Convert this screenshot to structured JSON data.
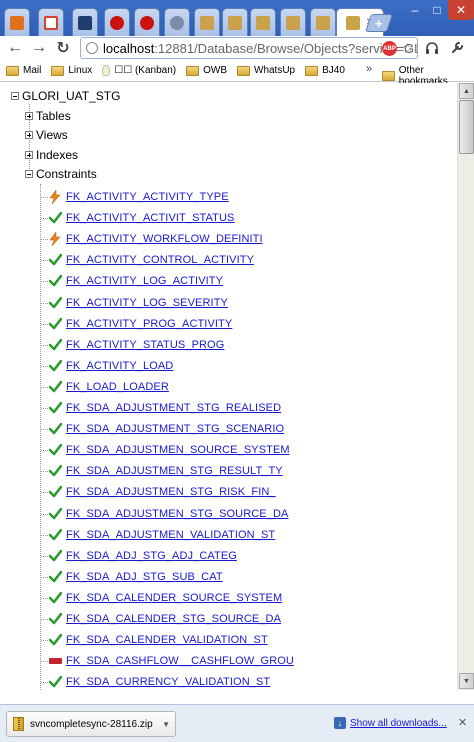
{
  "browser": {
    "tabs": [
      {
        "icon": "tc-icon",
        "color": "#e0701c"
      },
      {
        "icon": "gmail-icon",
        "color": "#d94030"
      },
      {
        "icon": "x-app-icon",
        "color": "#1e3c6c"
      },
      {
        "icon": "opera-icon",
        "color": "#cc1111"
      },
      {
        "icon": "opera-icon",
        "color": "#cc1111"
      },
      {
        "icon": "globe-icon",
        "color": "#7b8ca8"
      },
      {
        "icon": "page-icon",
        "color": "#c9a24a"
      },
      {
        "icon": "page-icon",
        "color": "#c9a24a"
      },
      {
        "icon": "page-icon",
        "color": "#c9a24a"
      },
      {
        "icon": "page-icon",
        "color": "#c9a24a"
      },
      {
        "icon": "page-icon",
        "color": "#c9a24a"
      }
    ],
    "active_tab_close": "✕",
    "new_tab": "+",
    "window_buttons": {
      "minimize": "–",
      "maximize": "□",
      "close": "✕"
    },
    "url_host": "localhost",
    "url_path": ":12881/Database/Browse/Objects?service=GLC",
    "abp_label": "ABP",
    "bookmarks": [
      {
        "label": "Mail",
        "icon": "folder-icon"
      },
      {
        "label": "Linux",
        "icon": "folder-icon"
      },
      {
        "label": "☐☐ (Kanban)",
        "icon": "bulb-icon"
      },
      {
        "label": "OWB",
        "icon": "folder-icon"
      },
      {
        "label": "WhatsUp",
        "icon": "folder-icon"
      },
      {
        "label": "BJ40",
        "icon": "folder-icon"
      }
    ],
    "bookmarks_overflow": "»",
    "other_bookmarks": "Other bookmarks"
  },
  "tree": {
    "root": "GLORI_UAT_STG",
    "nodes": [
      {
        "label": "Tables",
        "expanded": false
      },
      {
        "label": "Views",
        "expanded": false
      },
      {
        "label": "Indexes",
        "expanded": false
      },
      {
        "label": "Constraints",
        "expanded": true
      }
    ],
    "constraints": [
      {
        "name": "FK_ACTIVITY_ACTIVITY_TYPE",
        "status": "lightning"
      },
      {
        "name": "FK_ACTIVITY_ACTIVIT_STATUS",
        "status": "check"
      },
      {
        "name": "FK_ACTIVITY_WORKFLOW_DEFINITI",
        "status": "lightning"
      },
      {
        "name": "FK_ACTIVITY_CONTROL_ACTIVITY",
        "status": "check"
      },
      {
        "name": "FK_ACTIVITY_LOG_ACTIVITY",
        "status": "check"
      },
      {
        "name": "FK_ACTIVITY_LOG_SEVERITY",
        "status": "check"
      },
      {
        "name": "FK_ACTIVITY_PROG_ACTIVITY",
        "status": "check"
      },
      {
        "name": "FK_ACTIVITY_STATUS_PROG",
        "status": "check"
      },
      {
        "name": "FK_ACTIVITY_LOAD",
        "status": "check"
      },
      {
        "name": "FK_LOAD_LOADER",
        "status": "check"
      },
      {
        "name": "FK_SDA_ADJUSTMENT_STG_REALISED",
        "status": "check"
      },
      {
        "name": "FK_SDA_ADJUSTMENT_STG_SCENARIO",
        "status": "check"
      },
      {
        "name": "FK_SDA_ADJUSTMEN_SOURCE_SYSTEM",
        "status": "check"
      },
      {
        "name": "FK_SDA_ADJUSTMEN_STG_RESULT_TY",
        "status": "check"
      },
      {
        "name": "FK_SDA_ADJUSTMEN_STG_RISK_FIN_",
        "status": "check"
      },
      {
        "name": "FK_SDA_ADJUSTMEN_STG_SOURCE_DA",
        "status": "check"
      },
      {
        "name": "FK_SDA_ADJUSTMEN_VALIDATION_ST",
        "status": "check"
      },
      {
        "name": "FK_SDA_ADJ_STG_ADJ_CATEG",
        "status": "check"
      },
      {
        "name": "FK_SDA_ADJ_STG_SUB_CAT",
        "status": "check"
      },
      {
        "name": "FK_SDA_CALENDER_SOURCE_SYSTEM",
        "status": "check"
      },
      {
        "name": "FK_SDA_CALENDER_STG_SOURCE_DA",
        "status": "check"
      },
      {
        "name": "FK_SDA_CALENDER_VALIDATION_ST",
        "status": "check"
      },
      {
        "name": "FK_SDA_CASHFLOW__CASHFLOW_GROU",
        "status": "disabled"
      },
      {
        "name": "FK_SDA_CURRENCY_VALIDATION_ST",
        "status": "check"
      }
    ]
  },
  "download_shelf": {
    "file": "svncompletesync-28116.zip",
    "dropdown": "▼",
    "show_all": "Show all downloads...",
    "close": "✕"
  },
  "colors": {
    "link": "#1a1acc",
    "check": "#2e9b2e",
    "lightning": "#e8861a",
    "disabled": "#c0262c"
  }
}
